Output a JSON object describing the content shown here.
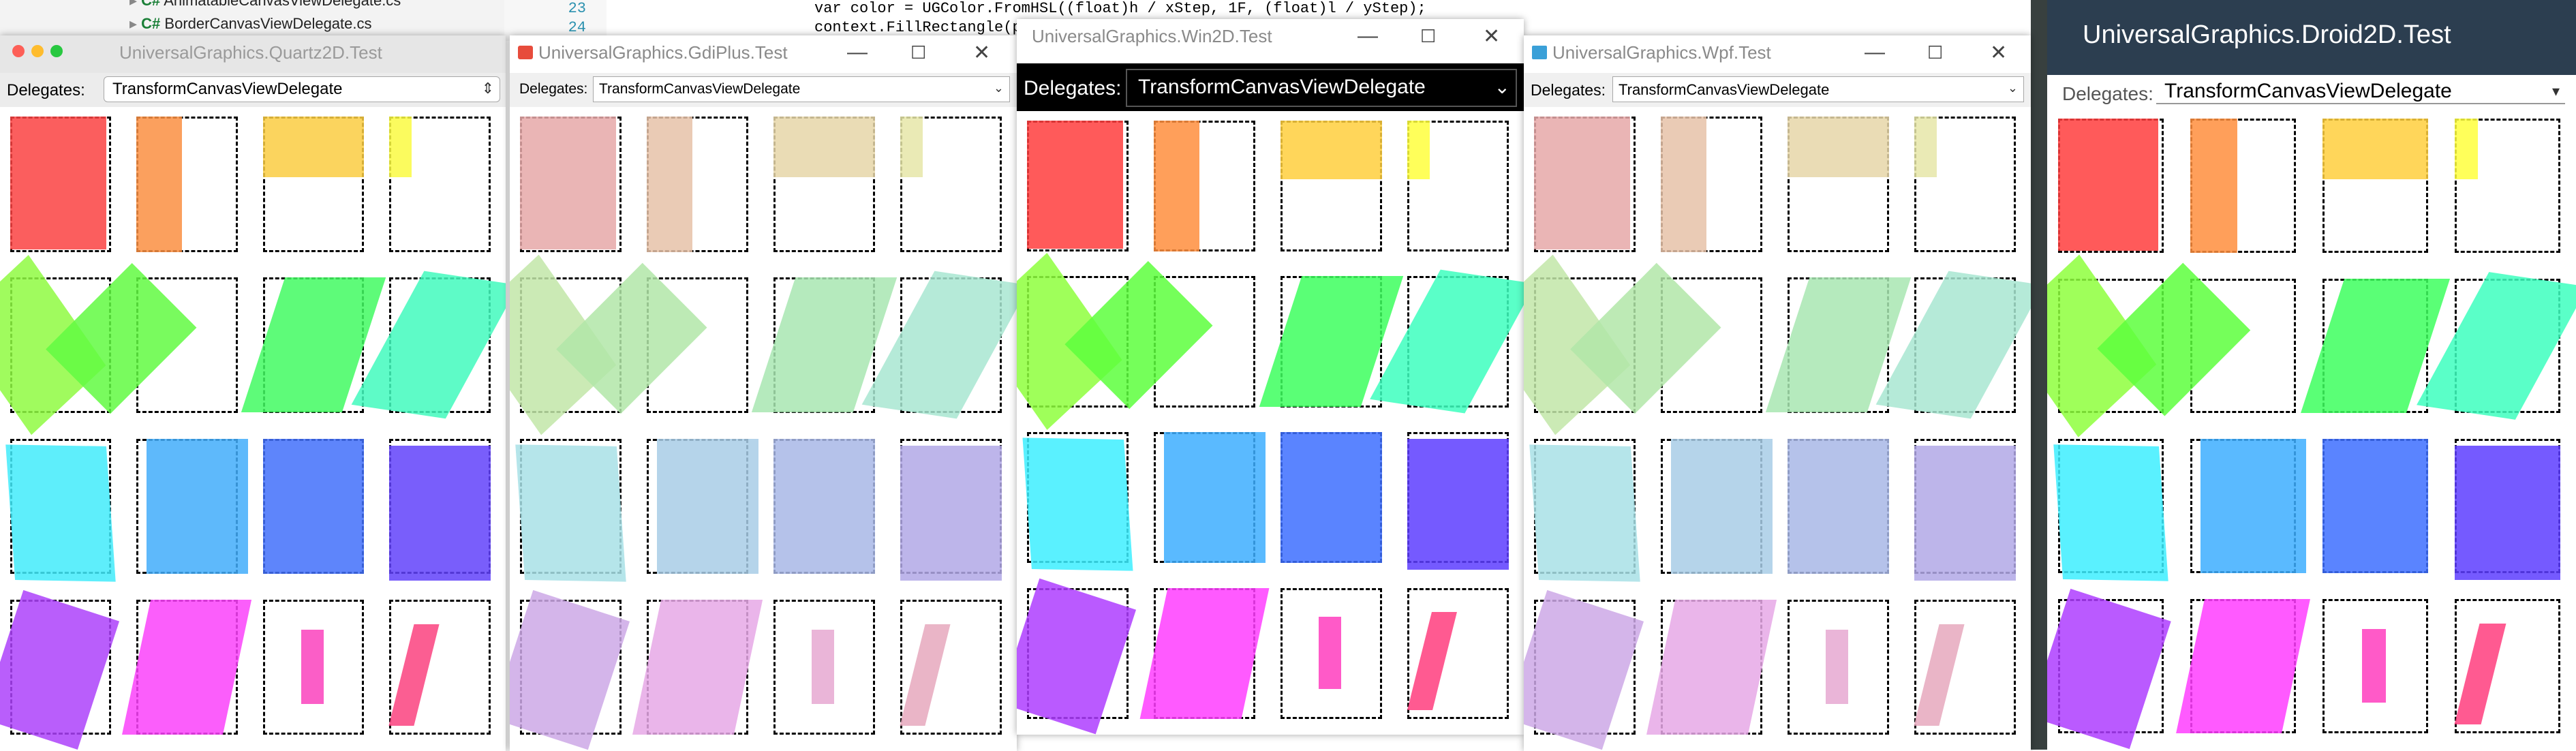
{
  "background": {
    "solution_items": [
      "AnimatableCanvasViewDelegate.cs",
      "BorderCanvasViewDelegate.cs"
    ],
    "file_badge": "C#",
    "code_lines": [
      {
        "num": "23",
        "text": "var color = UGColor.FromHSL((float)h / xStep, 1F, (float)l / yStep);"
      },
      {
        "num": "24",
        "text": "context.FillRectangle(p"
      }
    ]
  },
  "windows": [
    {
      "title": "UniversalGraphics.Quartz2D.Test",
      "delegates_label": "Delegates:",
      "selected_delegate": "TransformCanvasViewDelegate",
      "style": "mac"
    },
    {
      "title": "UniversalGraphics.GdiPlus.Test",
      "delegates_label": "Delegates:",
      "selected_delegate": "TransformCanvasViewDelegate",
      "style": "win"
    },
    {
      "title": "UniversalGraphics.Win2D.Test",
      "delegates_label": "Delegates:",
      "selected_delegate": "TransformCanvasViewDelegate",
      "style": "uwp"
    },
    {
      "title": "UniversalGraphics.Wpf.Test",
      "delegates_label": "Delegates:",
      "selected_delegate": "TransformCanvasViewDelegate",
      "style": "win"
    },
    {
      "title": "UniversalGraphics.Droid2D.Test",
      "delegates_label": "Delegates:",
      "selected_delegate": "TransformCanvasViewDelegate",
      "style": "android"
    }
  ],
  "icons": {
    "window_minimize": "minimize-icon",
    "window_maximize": "maximize-icon",
    "window_close": "close-icon",
    "dropdown": "chevron-down-icon",
    "app": "app-icon"
  },
  "colors": {
    "mac_close": "#fd5f57",
    "mac_minimize": "#febc2e",
    "mac_maximize": "#28c840",
    "uwp_dark": "#000000",
    "android_bar": "#2c3e50"
  }
}
